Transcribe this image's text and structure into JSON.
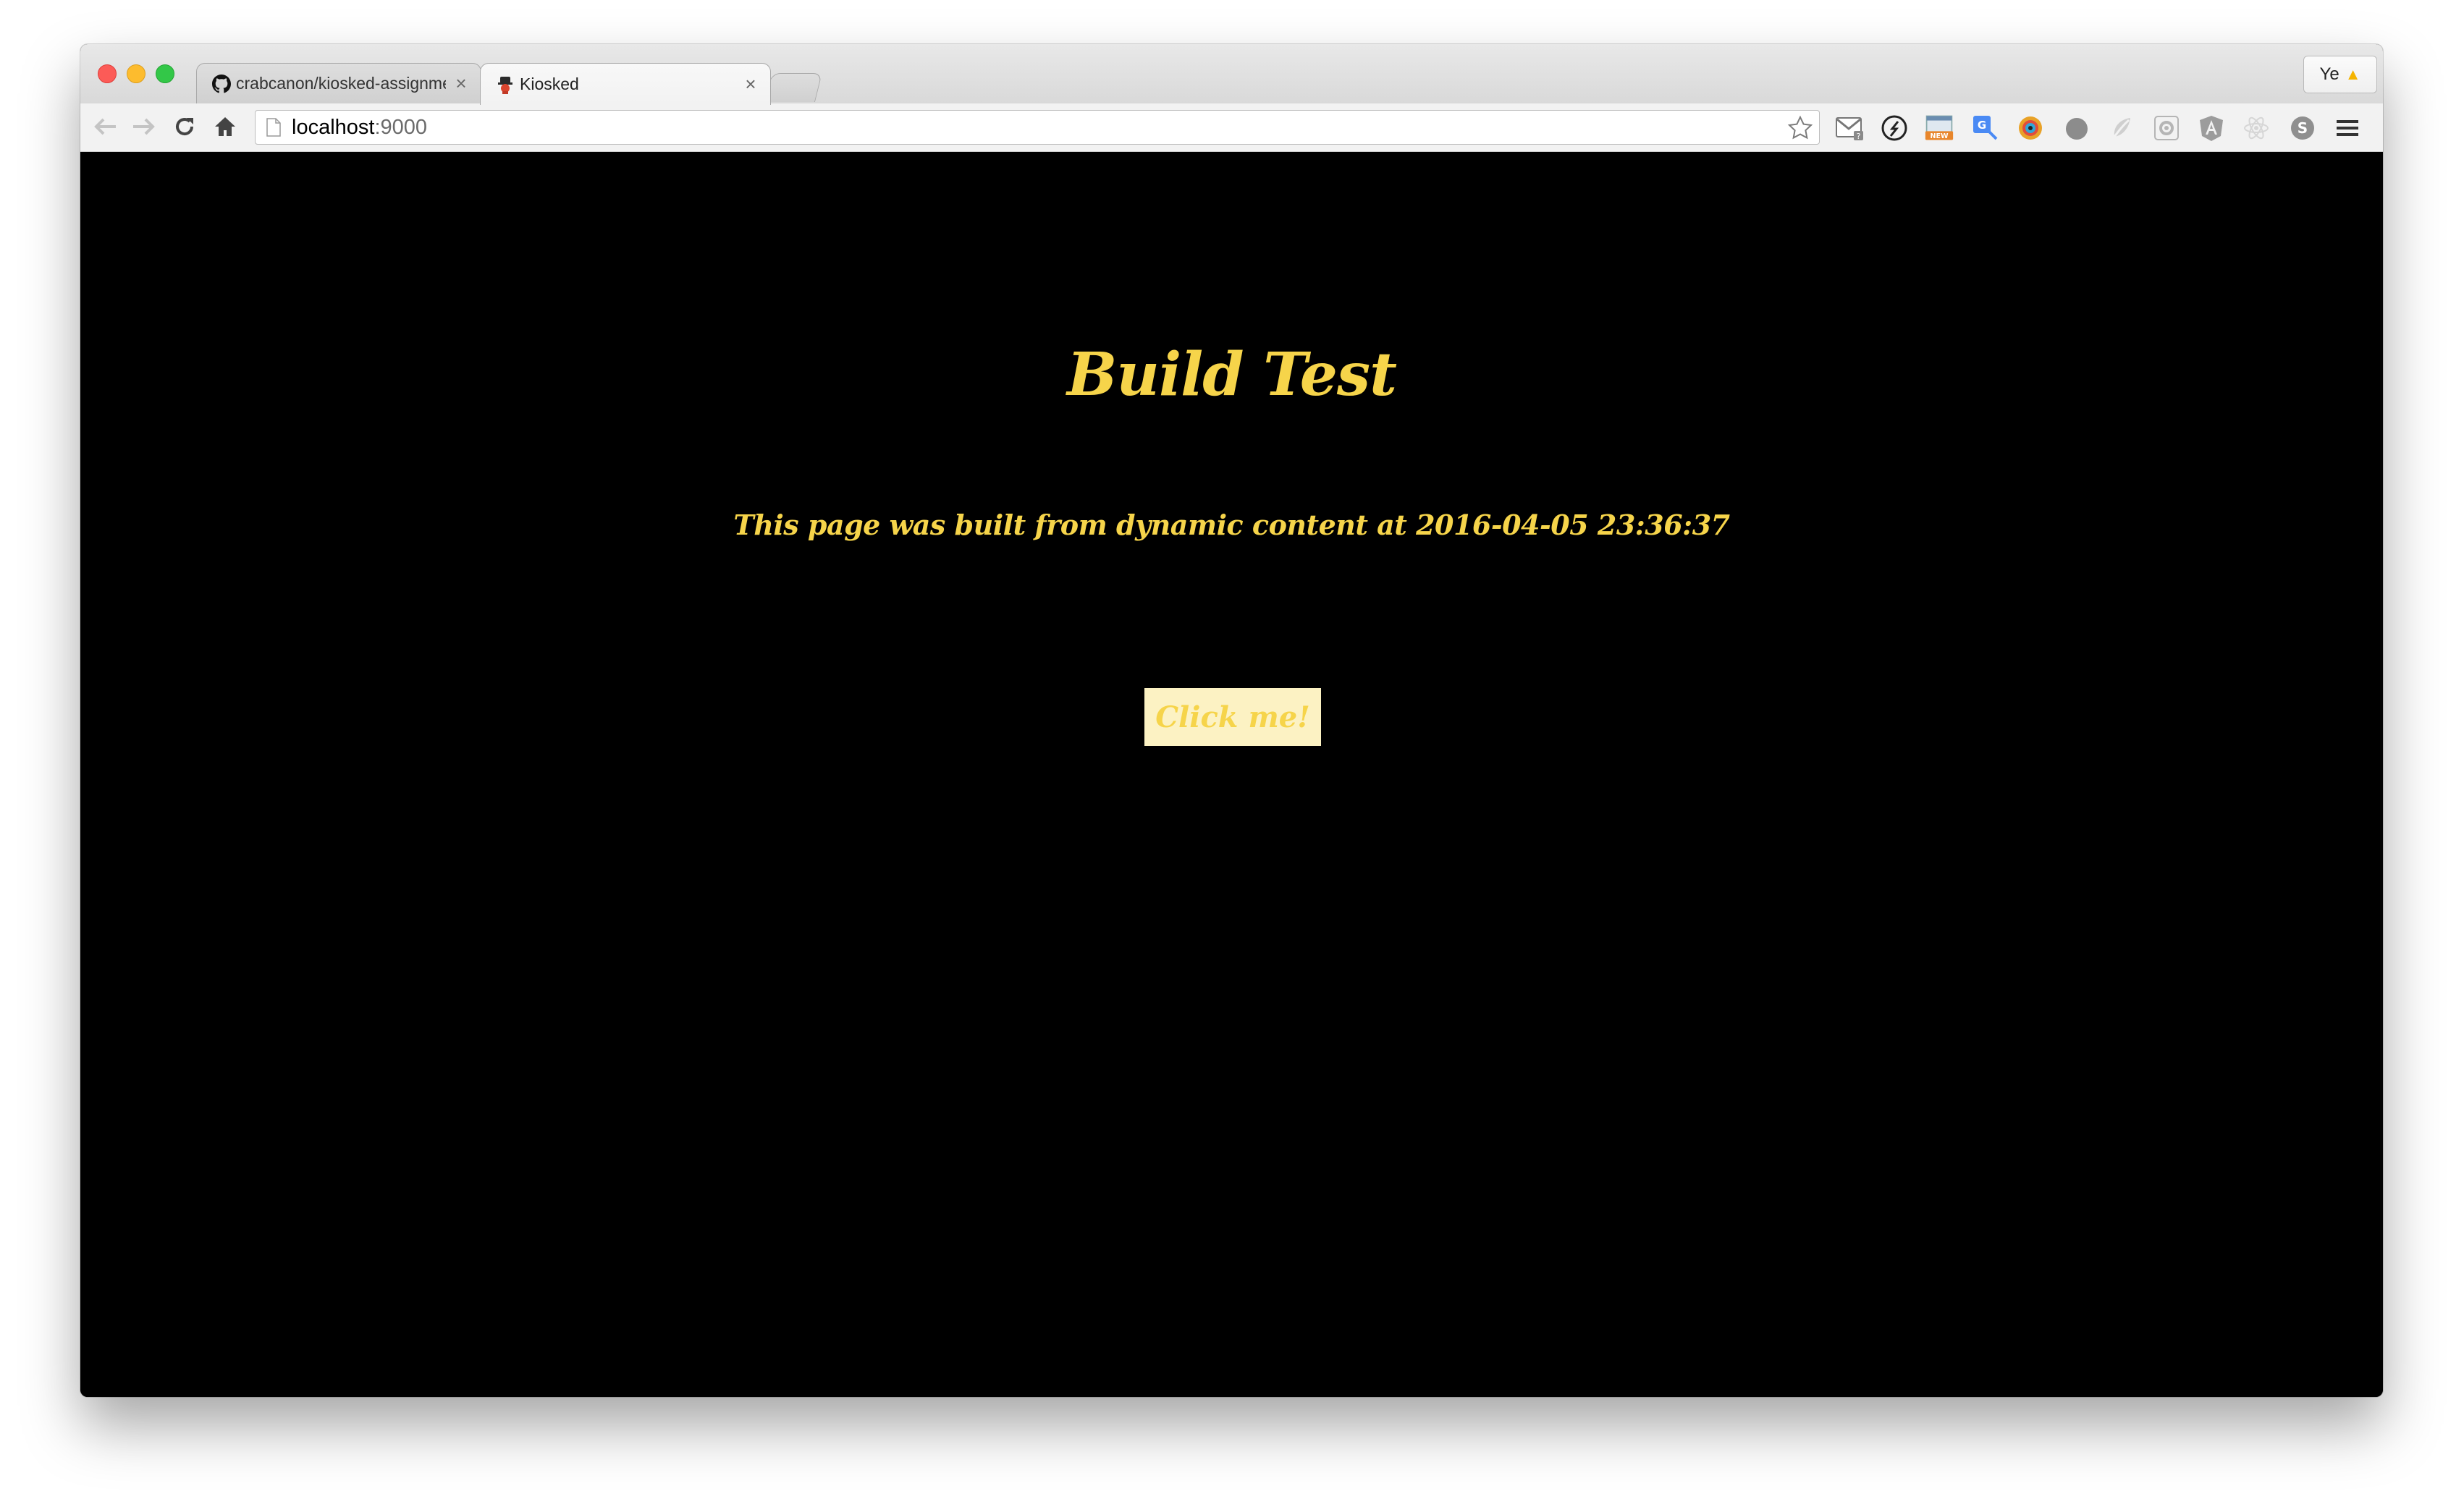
{
  "browser": {
    "tabs": [
      {
        "title": "crabcanon/kiosked-assignment",
        "icon": "github-icon",
        "active": false
      },
      {
        "title": "Kiosked",
        "icon": "kiosked-favicon",
        "active": true
      }
    ],
    "profile": {
      "label": "Ye",
      "warning_icon": "warning-icon"
    },
    "omnibox": {
      "host": "localhost",
      "port": ":9000"
    },
    "extensions": [
      "gmail-checker-icon",
      "compass-icon",
      "new-badge-icon",
      "translate-icon",
      "color-picker-icon",
      "circle-icon",
      "leaf-icon",
      "settings-cog-icon",
      "angular-icon",
      "react-icon",
      "skype-icon",
      "menu-icon"
    ],
    "new_badge_label": "NEW"
  },
  "page": {
    "title": "Build Test",
    "subtitle": "This page was built from dynamic content at 2016-04-05 23:36:37",
    "button_label": "Click me!",
    "colors": {
      "background": "#000000",
      "text": "#f6d44a",
      "button_bg": "#fcf2c3"
    }
  }
}
